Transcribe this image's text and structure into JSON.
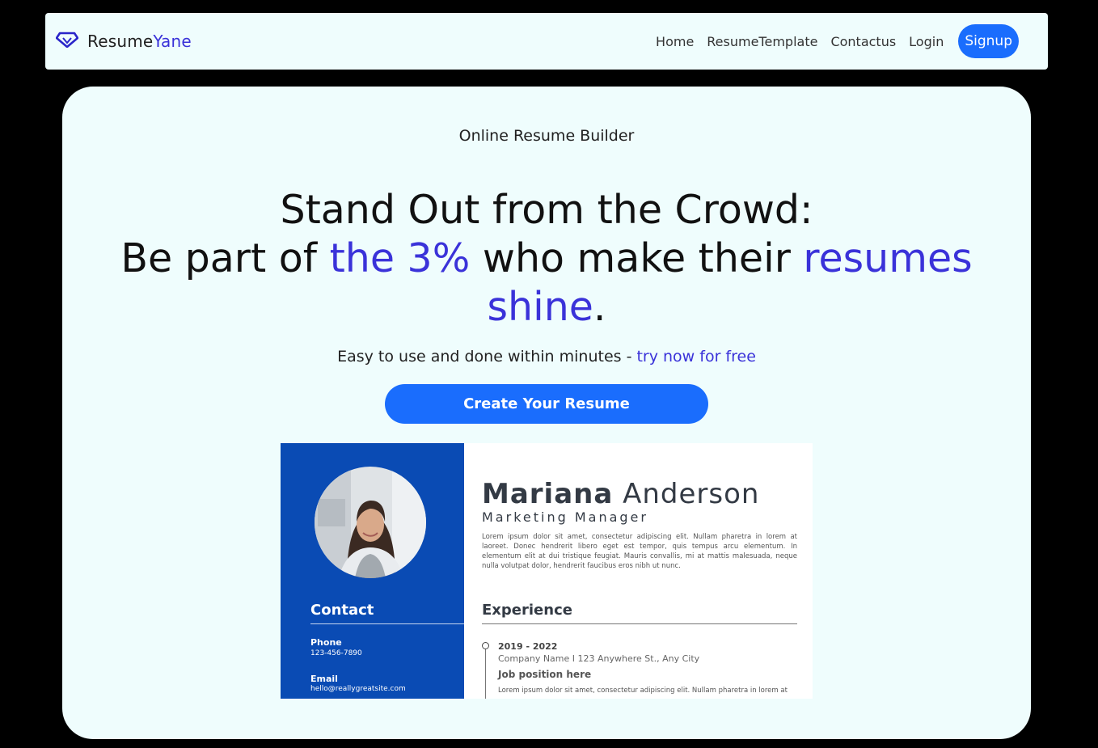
{
  "brand": {
    "name_prefix": "Resume",
    "name_accent": "Yane"
  },
  "nav": {
    "links": [
      "Home",
      "ResumeTemplate",
      "Contactus",
      "Login"
    ],
    "signup_label": "Signup"
  },
  "hero": {
    "eyebrow": "Online Resume Builder",
    "headline_line1": "Stand Out from the Crowd:",
    "headline_part1": "Be part of ",
    "headline_accent1": "the 3%",
    "headline_part2": " who make their ",
    "headline_accent2": "resumes shine",
    "headline_end": ".",
    "subline_text": "Easy to use and done within minutes - ",
    "subline_link": "try now for free",
    "cta_label": "Create Your Resume"
  },
  "resume_preview": {
    "first_name": "Mariana",
    "last_name": " Anderson",
    "job_title": "Marketing Manager",
    "summary": "Lorem ipsum dolor sit amet, consectetur adipiscing elit. Nullam pharetra in lorem at laoreet. Donec hendrerit libero eget est tempor, quis tempus arcu elementum. In elementum elit at dui tristique feugiat. Mauris convallis, mi at mattis malesuada, neque nulla volutpat dolor, hendrerit faucibus eros nibh ut nunc.",
    "contact_heading": "Contact",
    "phone_label": "Phone",
    "phone_value": "123-456-7890",
    "email_label": "Email",
    "email_value": "hello@reallygreatsite.com",
    "experience_heading": "Experience",
    "exp_dates": "2019 - 2022",
    "exp_company": "Company Name I 123 Anywhere St., Any City",
    "exp_role": "Job position here",
    "exp_desc": "Lorem ipsum dolor sit amet, consectetur adipiscing elit. Nullam pharetra in lorem at"
  },
  "colors": {
    "accent": "#3a32d9",
    "primary_button": "#1a6dfd",
    "resume_sidebar": "#0a4bb4",
    "card_background": "#effdfd"
  },
  "icons": {
    "brand_logo": "diamond-logo-icon"
  }
}
